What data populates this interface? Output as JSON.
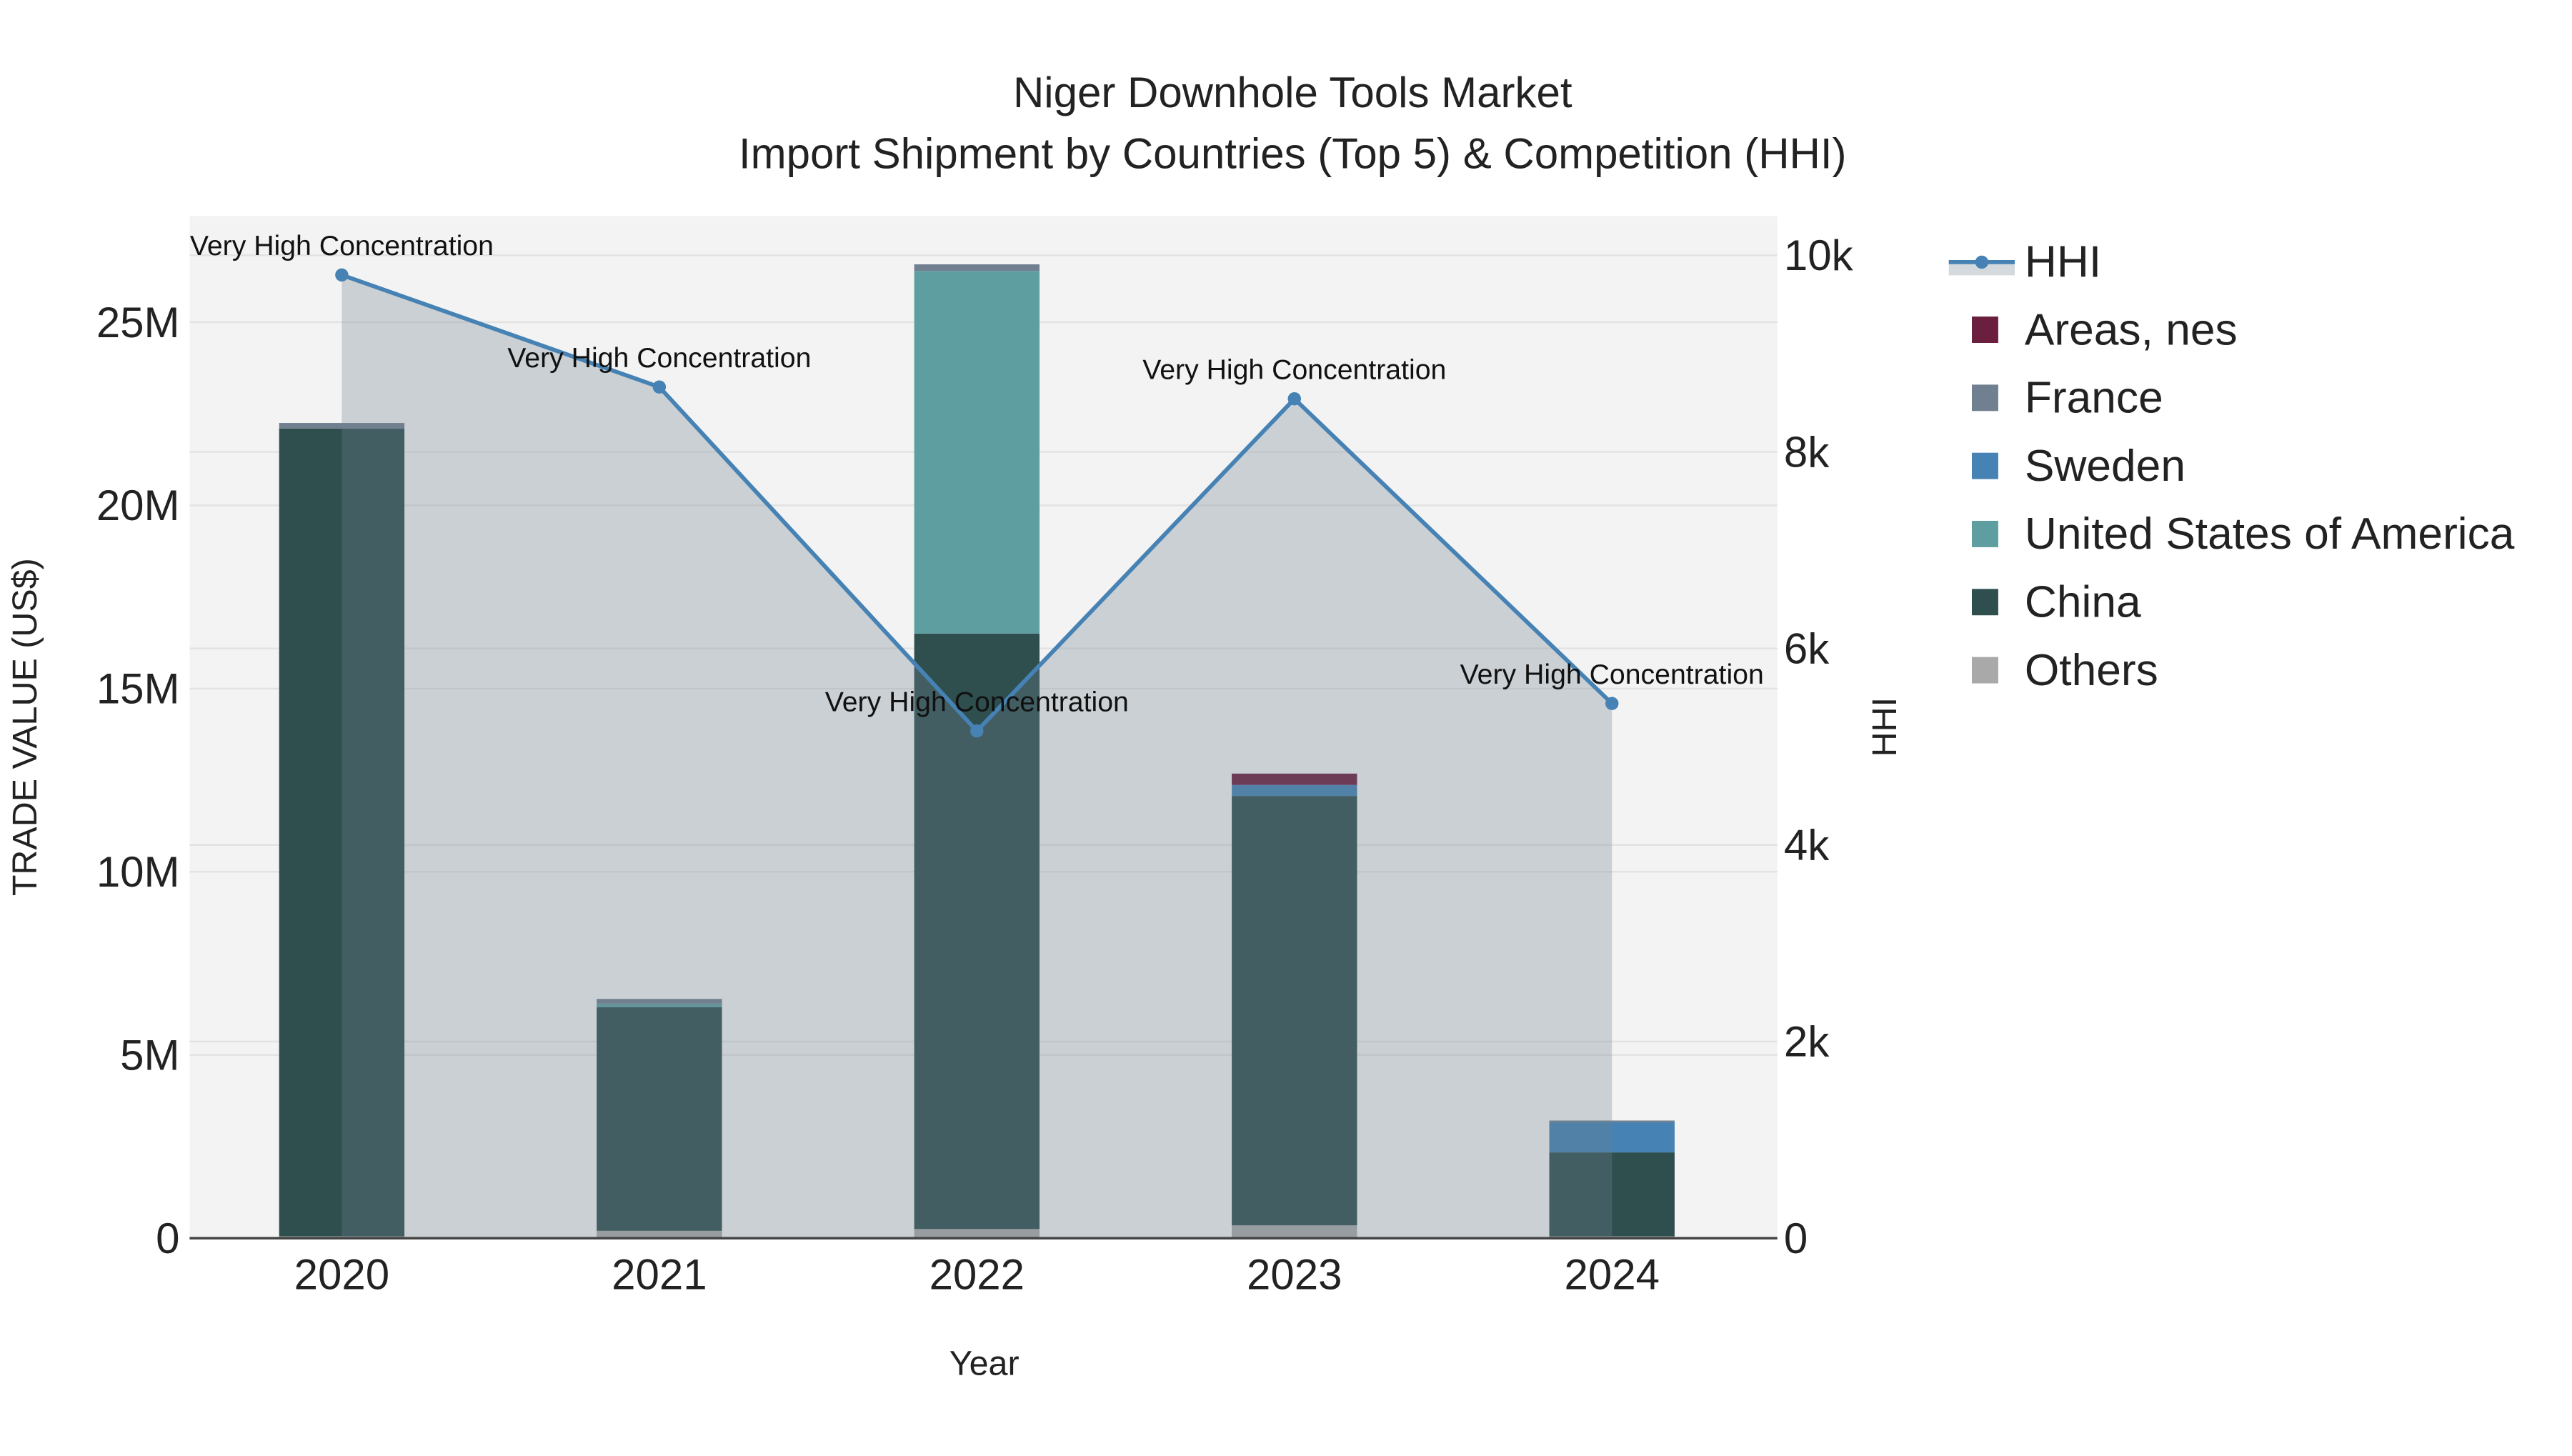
{
  "chart_data": {
    "type": "bar",
    "title": "Niger Downhole Tools Market",
    "subtitle": "Import Shipment by Countries (Top 5) & Competition (HHI)",
    "xlabel": "Year",
    "ylabel": "TRADE VALUE (US$)",
    "y2label": "HHI",
    "categories": [
      "2020",
      "2021",
      "2022",
      "2023",
      "2024"
    ],
    "ylim": [
      0,
      27900000
    ],
    "y2lim": [
      0,
      10400
    ],
    "yticks": [
      {
        "v": 0,
        "label": "0"
      },
      {
        "v": 5000000,
        "label": "5M"
      },
      {
        "v": 10000000,
        "label": "10M"
      },
      {
        "v": 15000000,
        "label": "15M"
      },
      {
        "v": 20000000,
        "label": "20M"
      },
      {
        "v": 25000000,
        "label": "25M"
      }
    ],
    "y2ticks": [
      {
        "v": 0,
        "label": "0"
      },
      {
        "v": 2000,
        "label": "2k"
      },
      {
        "v": 4000,
        "label": "4k"
      },
      {
        "v": 6000,
        "label": "6k"
      },
      {
        "v": 8000,
        "label": "8k"
      },
      {
        "v": 10000,
        "label": "10k"
      }
    ],
    "series": [
      {
        "name": "Others",
        "color": "#A9A9A9",
        "values": [
          50000,
          200000,
          250000,
          350000,
          50000
        ]
      },
      {
        "name": "China",
        "color": "#2F4F4F",
        "values": [
          22050000,
          6100000,
          16250000,
          11720000,
          2290000
        ]
      },
      {
        "name": "United States of America",
        "color": "#5F9EA0",
        "values": [
          0,
          100000,
          9900000,
          0,
          0
        ]
      },
      {
        "name": "Sweden",
        "color": "#4682B4",
        "values": [
          0,
          0,
          0,
          300000,
          820000
        ]
      },
      {
        "name": "France",
        "color": "#708090",
        "values": [
          150000,
          130000,
          180000,
          0,
          50000
        ]
      },
      {
        "name": "Areas, nes",
        "color": "#6B1F3F",
        "values": [
          0,
          0,
          0,
          310000,
          0
        ]
      }
    ],
    "hhi": {
      "name": "HHI",
      "color": "#4682B4",
      "values": [
        9800,
        8660,
        5160,
        8540,
        5440
      ],
      "annotations": [
        "Very High Concentration",
        "Very High Concentration",
        "Very High Concentration",
        "Very High Concentration",
        "Very High Concentration"
      ]
    },
    "legend": [
      "HHI",
      "Areas, nes",
      "France",
      "Sweden",
      "United States of America",
      "China",
      "Others"
    ],
    "legend_position": "right",
    "grid": true
  }
}
